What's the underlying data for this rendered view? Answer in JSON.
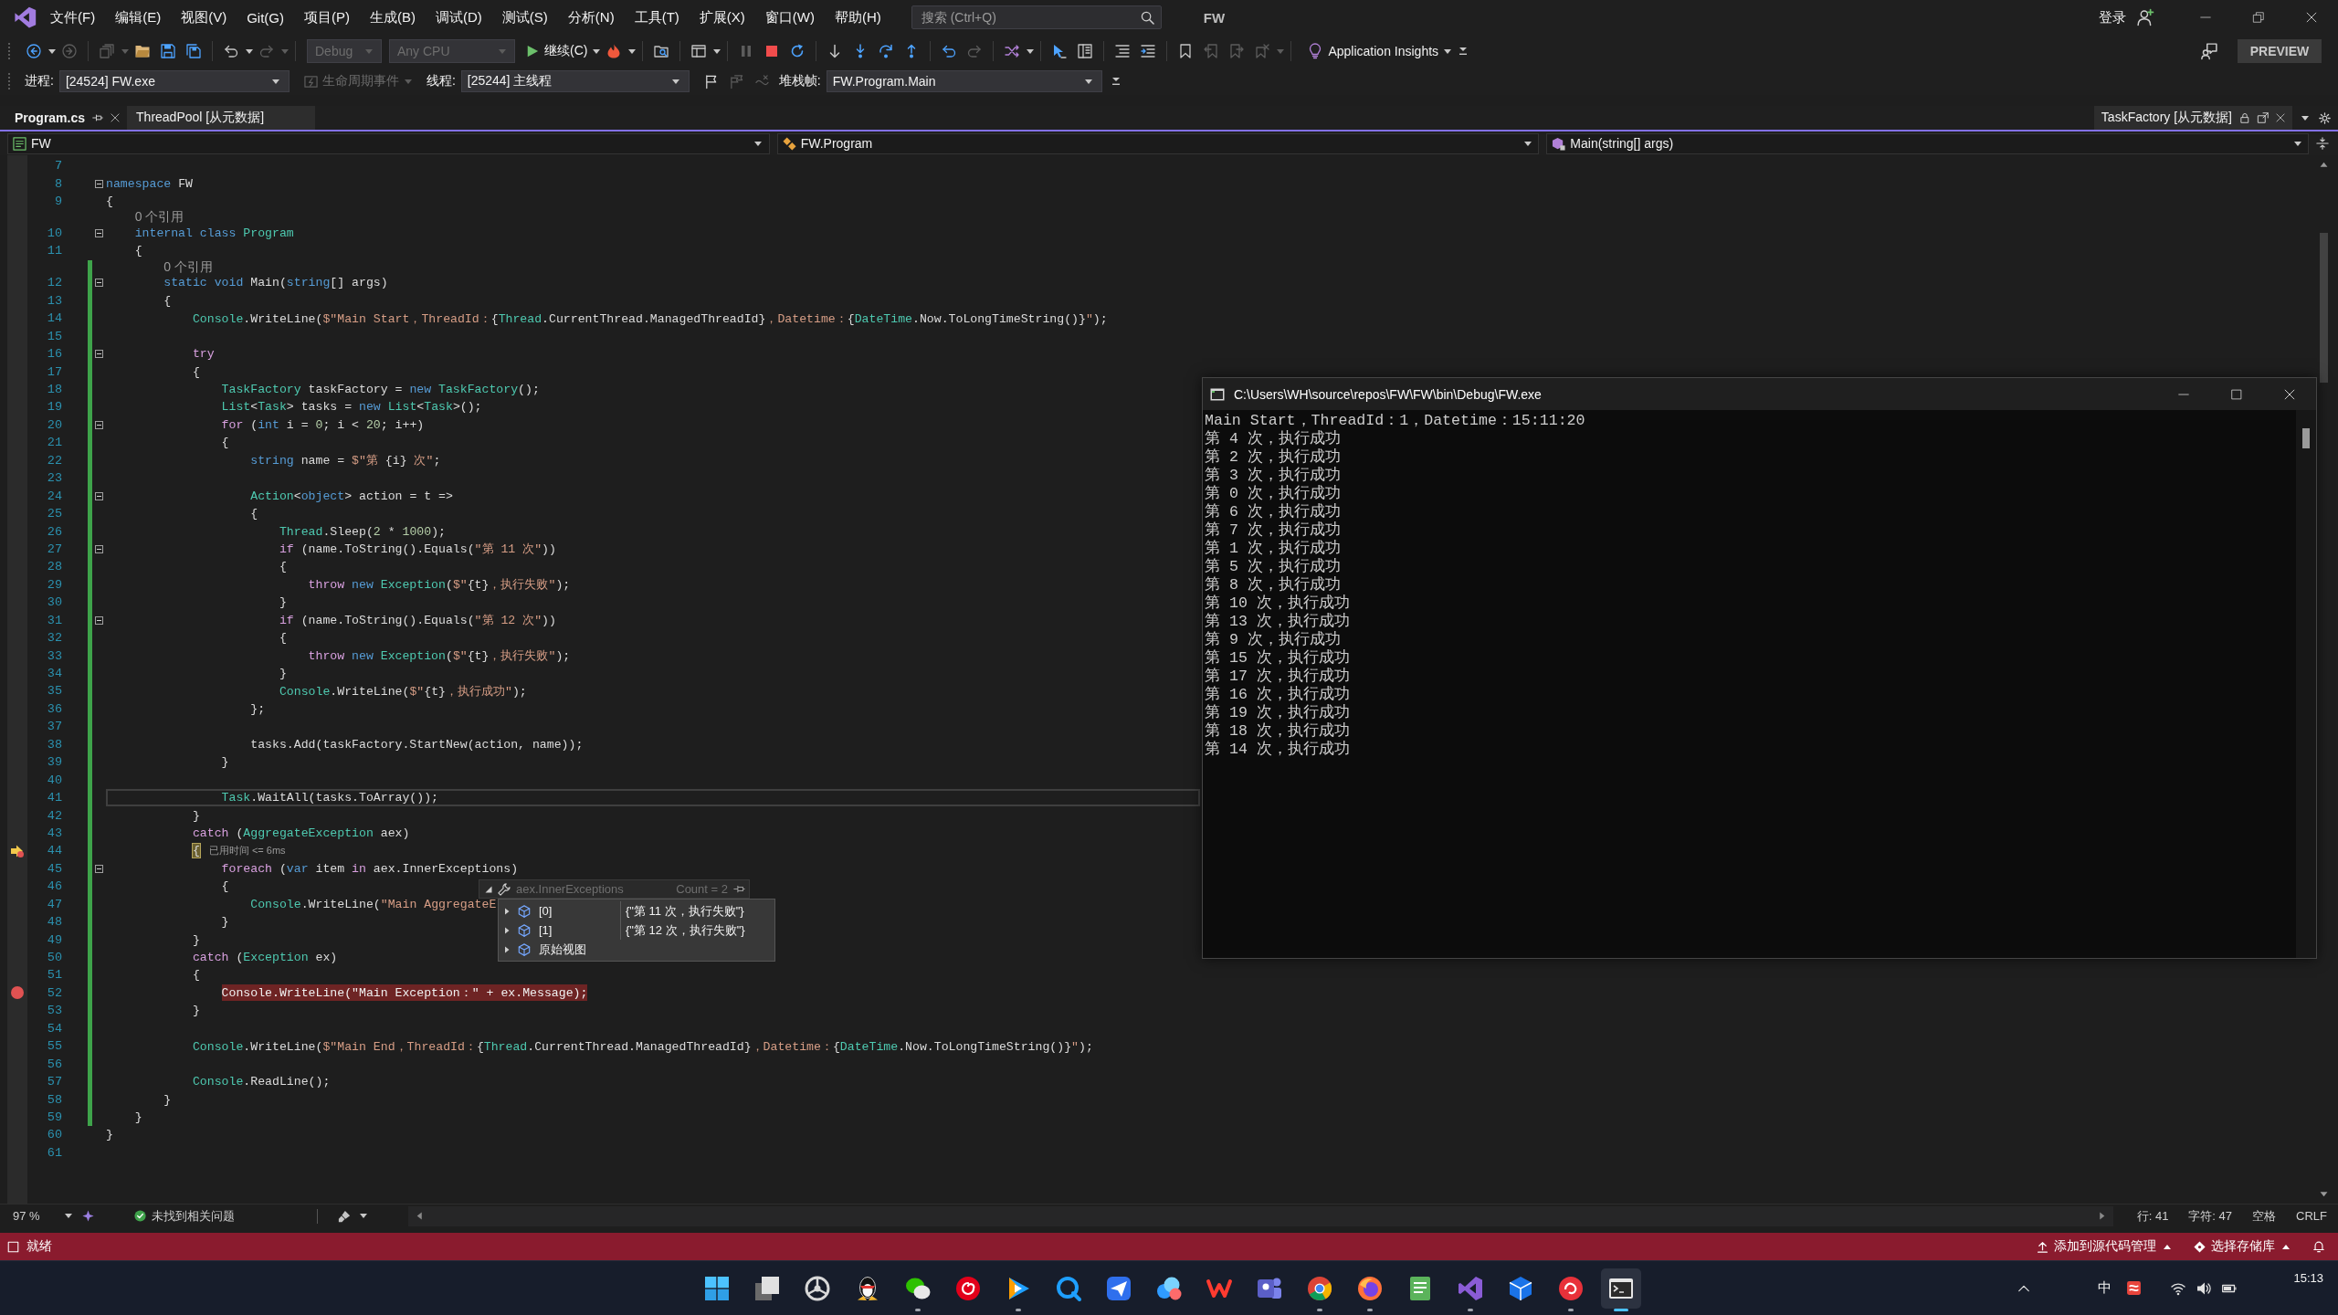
{
  "title_bar": {
    "menu": [
      "文件(F)",
      "编辑(E)",
      "视图(V)",
      "Git(G)",
      "项目(P)",
      "生成(B)",
      "调试(D)",
      "测试(S)",
      "分析(N)",
      "工具(T)",
      "扩展(X)",
      "窗口(W)",
      "帮助(H)"
    ],
    "search": {
      "placeholder": "搜索 (Ctrl+Q)"
    },
    "solution": "FW",
    "sign_in": "登录"
  },
  "standard_toolbar": {
    "groups": [
      [
        {
          "kind": "back",
          "disabled": false
        },
        {
          "kind": "forward",
          "disabled": true
        }
      ],
      [
        {
          "kind": "new-item",
          "disabled": true
        },
        {
          "kind": "open-folder",
          "disabled": false
        },
        {
          "kind": "save",
          "disabled": false
        },
        {
          "kind": "save-all",
          "disabled": false
        }
      ],
      [
        {
          "kind": "undo",
          "disabled": false
        },
        {
          "kind": "redo",
          "disabled": true
        }
      ],
      [
        {
          "kind": "dropdown",
          "label": "Debug",
          "disabled": true
        },
        {
          "kind": "dropdown",
          "label": "Any CPU",
          "disabled": true
        },
        {
          "kind": "continue",
          "label": "继续(C)",
          "disabled": false
        },
        {
          "kind": "hot-reload",
          "disabled": false
        }
      ],
      [
        {
          "kind": "find",
          "disabled": false
        }
      ],
      [
        {
          "kind": "windows",
          "disabled": false
        }
      ],
      [
        {
          "kind": "pause",
          "disabled": true
        },
        {
          "kind": "stop",
          "disabled": false
        },
        {
          "kind": "restart",
          "disabled": false
        }
      ],
      [
        {
          "kind": "show-next",
          "disabled": false
        },
        {
          "kind": "step-into",
          "disabled": false
        },
        {
          "kind": "step-over",
          "disabled": false
        },
        {
          "kind": "step-out",
          "disabled": false
        }
      ],
      [
        {
          "kind": "step-back",
          "disabled": false
        },
        {
          "kind": "step-forward",
          "disabled": true
        }
      ],
      [
        {
          "kind": "threads",
          "disabled": false
        }
      ],
      [
        {
          "kind": "pointer",
          "disabled": false
        },
        {
          "kind": "columns",
          "disabled": false
        }
      ],
      [
        {
          "kind": "comment",
          "disabled": false
        },
        {
          "kind": "uncomment",
          "disabled": false
        }
      ],
      [
        {
          "kind": "bookmark",
          "disabled": false
        },
        {
          "kind": "bookmark-prev",
          "disabled": true
        },
        {
          "kind": "bookmark-next",
          "disabled": true
        },
        {
          "kind": "bookmark-clear",
          "disabled": true
        }
      ],
      [
        {
          "kind": "insights",
          "label": "Application Insights",
          "disabled": false
        }
      ]
    ],
    "preview_button": "PREVIEW"
  },
  "debug_location_toolbar": {
    "process_label": "进程:",
    "process": "[24524] FW.exe",
    "lifecycle_events": {
      "label": "生命周期事件",
      "disabled": true
    },
    "thread_label": "线程:",
    "thread": "[25244] 主线程",
    "thread_flags": [
      {
        "kind": "flag",
        "disabled": false
      },
      {
        "kind": "flags",
        "disabled": true
      },
      {
        "kind": "filter",
        "disabled": true
      }
    ],
    "stack_frame_label": "堆栈帧:",
    "stack_frame": "FW.Program.Main"
  },
  "document_tabs": [
    {
      "label": "Program.cs",
      "selected": true
    },
    {
      "label": "ThreadPool [从元数据]",
      "selected": false
    }
  ],
  "preview_tab": {
    "label": "TaskFactory [从元数据]"
  },
  "navigation_bar": {
    "project": "FW",
    "type": "FW.Program",
    "member": "Main(string[] args)"
  },
  "editor": {
    "lines": [
      {
        "kind": "code",
        "number": "7",
        "changed": false
      },
      {
        "kind": "code",
        "number": "8",
        "changed": false,
        "expanded": true,
        "tokens": [
          {
            "kind": "keyword",
            "text": "namespace"
          },
          {
            "kind": "plain",
            "text": " FW"
          }
        ]
      },
      {
        "kind": "code",
        "number": "9",
        "changed": false,
        "tokens": [
          {
            "kind": "plain",
            "text": "{"
          }
        ]
      },
      {
        "kind": "codelens",
        "text": "    0 个引用",
        "changed": false
      },
      {
        "kind": "code",
        "number": "10",
        "changed": false,
        "expanded": true,
        "tokens": [
          {
            "kind": "keyword",
            "text": "    internal class "
          },
          {
            "kind": "type",
            "text": "Program"
          }
        ]
      },
      {
        "kind": "code",
        "number": "11",
        "changed": false,
        "tokens": [
          {
            "kind": "plain",
            "text": "    {"
          }
        ]
      },
      {
        "kind": "codelens",
        "text": "        0 个引用",
        "changed": true
      },
      {
        "kind": "code",
        "number": "12",
        "changed": true,
        "expanded": true,
        "tokens": [
          {
            "kind": "keyword",
            "text": "        static void"
          },
          {
            "kind": "plain",
            "text": " Main("
          },
          {
            "kind": "keyword",
            "text": "string"
          },
          {
            "kind": "plain",
            "text": "[] args)"
          }
        ]
      },
      {
        "kind": "code",
        "number": "13",
        "changed": true,
        "tokens": [
          {
            "kind": "plain",
            "text": "        {"
          }
        ]
      },
      {
        "kind": "code",
        "number": "14",
        "changed": true,
        "tokens": [
          {
            "kind": "type",
            "text": "            Console"
          },
          {
            "kind": "plain",
            "text": ".WriteLine("
          },
          {
            "kind": "string",
            "text": "$\"Main Start，ThreadId："
          },
          {
            "kind": "plain",
            "text": "{"
          },
          {
            "kind": "type",
            "text": "Thread"
          },
          {
            "kind": "plain",
            "text": ".CurrentThread.ManagedThreadId}"
          },
          {
            "kind": "string",
            "text": "，Datetime："
          },
          {
            "kind": "plain",
            "text": "{"
          },
          {
            "kind": "type",
            "text": "DateTime"
          },
          {
            "kind": "plain",
            "text": ".Now.ToLongTimeString()}"
          },
          {
            "kind": "string",
            "text": "\""
          },
          {
            "kind": "plain",
            "text": ");"
          }
        ]
      },
      {
        "kind": "code",
        "number": "15",
        "changed": true
      },
      {
        "kind": "code",
        "number": "16",
        "changed": true,
        "expanded": true,
        "tokens": [
          {
            "kind": "control",
            "text": "            try"
          }
        ]
      },
      {
        "kind": "code",
        "number": "17",
        "changed": true,
        "tokens": [
          {
            "kind": "plain",
            "text": "            {"
          }
        ]
      },
      {
        "kind": "code",
        "number": "18",
        "changed": true,
        "tokens": [
          {
            "kind": "type",
            "text": "                TaskFactory"
          },
          {
            "kind": "plain",
            "text": " taskFactory = "
          },
          {
            "kind": "keyword",
            "text": "new "
          },
          {
            "kind": "type",
            "text": "TaskFactory"
          },
          {
            "kind": "plain",
            "text": "();"
          }
        ]
      },
      {
        "kind": "code",
        "number": "19",
        "changed": true,
        "tokens": [
          {
            "kind": "type",
            "text": "                List"
          },
          {
            "kind": "plain",
            "text": "<"
          },
          {
            "kind": "type",
            "text": "Task"
          },
          {
            "kind": "plain",
            "text": "> tasks = "
          },
          {
            "kind": "keyword",
            "text": "new "
          },
          {
            "kind": "type",
            "text": "List"
          },
          {
            "kind": "plain",
            "text": "<"
          },
          {
            "kind": "type",
            "text": "Task"
          },
          {
            "kind": "plain",
            "text": ">();"
          }
        ]
      },
      {
        "kind": "code",
        "number": "20",
        "changed": true,
        "expanded": true,
        "tokens": [
          {
            "kind": "control",
            "text": "                for"
          },
          {
            "kind": "plain",
            "text": " ("
          },
          {
            "kind": "keyword",
            "text": "int"
          },
          {
            "kind": "plain",
            "text": " i = "
          },
          {
            "kind": "number",
            "text": "0"
          },
          {
            "kind": "plain",
            "text": "; i < "
          },
          {
            "kind": "number",
            "text": "20"
          },
          {
            "kind": "plain",
            "text": "; i++)"
          }
        ]
      },
      {
        "kind": "code",
        "number": "21",
        "changed": true,
        "tokens": [
          {
            "kind": "plain",
            "text": "                {"
          }
        ]
      },
      {
        "kind": "code",
        "number": "22",
        "changed": true,
        "tokens": [
          {
            "kind": "keyword",
            "text": "                    string"
          },
          {
            "kind": "plain",
            "text": " name = "
          },
          {
            "kind": "string",
            "text": "$\"第 "
          },
          {
            "kind": "plain",
            "text": "{i}"
          },
          {
            "kind": "string",
            "text": " 次\""
          },
          {
            "kind": "plain",
            "text": ";"
          }
        ]
      },
      {
        "kind": "code",
        "number": "23",
        "changed": true
      },
      {
        "kind": "code",
        "number": "24",
        "changed": true,
        "expanded": true,
        "tokens": [
          {
            "kind": "type",
            "text": "                    Action"
          },
          {
            "kind": "plain",
            "text": "<"
          },
          {
            "kind": "keyword",
            "text": "object"
          },
          {
            "kind": "plain",
            "text": "> action = t =>"
          }
        ]
      },
      {
        "kind": "code",
        "number": "25",
        "changed": true,
        "tokens": [
          {
            "kind": "plain",
            "text": "                    {"
          }
        ]
      },
      {
        "kind": "code",
        "number": "26",
        "changed": true,
        "tokens": [
          {
            "kind": "type",
            "text": "                        Thread"
          },
          {
            "kind": "plain",
            "text": ".Sleep("
          },
          {
            "kind": "number",
            "text": "2"
          },
          {
            "kind": "plain",
            "text": " * "
          },
          {
            "kind": "number",
            "text": "1000"
          },
          {
            "kind": "plain",
            "text": ");"
          }
        ]
      },
      {
        "kind": "code",
        "number": "27",
        "changed": true,
        "expanded": true,
        "tokens": [
          {
            "kind": "control",
            "text": "                        if"
          },
          {
            "kind": "plain",
            "text": " (name.ToString().Equals("
          },
          {
            "kind": "string",
            "text": "\"第 11 次\""
          },
          {
            "kind": "plain",
            "text": "))"
          }
        ]
      },
      {
        "kind": "code",
        "number": "28",
        "changed": true,
        "tokens": [
          {
            "kind": "plain",
            "text": "                        {"
          }
        ]
      },
      {
        "kind": "code",
        "number": "29",
        "changed": true,
        "tokens": [
          {
            "kind": "control",
            "text": "                            throw "
          },
          {
            "kind": "keyword",
            "text": "new "
          },
          {
            "kind": "type",
            "text": "Exception"
          },
          {
            "kind": "plain",
            "text": "("
          },
          {
            "kind": "string",
            "text": "$\""
          },
          {
            "kind": "plain",
            "text": "{t}"
          },
          {
            "kind": "string",
            "text": "，执行失败\""
          },
          {
            "kind": "plain",
            "text": ");"
          }
        ]
      },
      {
        "kind": "code",
        "number": "30",
        "changed": true,
        "tokens": [
          {
            "kind": "plain",
            "text": "                        }"
          }
        ]
      },
      {
        "kind": "code",
        "number": "31",
        "changed": true,
        "expanded": true,
        "tokens": [
          {
            "kind": "control",
            "text": "                        if"
          },
          {
            "kind": "plain",
            "text": " (name.ToString().Equals("
          },
          {
            "kind": "string",
            "text": "\"第 12 次\""
          },
          {
            "kind": "plain",
            "text": "))"
          }
        ]
      },
      {
        "kind": "code",
        "number": "32",
        "changed": true,
        "tokens": [
          {
            "kind": "plain",
            "text": "                        {"
          }
        ]
      },
      {
        "kind": "code",
        "number": "33",
        "changed": true,
        "tokens": [
          {
            "kind": "control",
            "text": "                            throw "
          },
          {
            "kind": "keyword",
            "text": "new "
          },
          {
            "kind": "type",
            "text": "Exception"
          },
          {
            "kind": "plain",
            "text": "("
          },
          {
            "kind": "string",
            "text": "$\""
          },
          {
            "kind": "plain",
            "text": "{t}"
          },
          {
            "kind": "string",
            "text": "，执行失败\""
          },
          {
            "kind": "plain",
            "text": ");"
          }
        ]
      },
      {
        "kind": "code",
        "number": "34",
        "changed": true,
        "tokens": [
          {
            "kind": "plain",
            "text": "                        }"
          }
        ]
      },
      {
        "kind": "code",
        "number": "35",
        "changed": true,
        "tokens": [
          {
            "kind": "type",
            "text": "                        Console"
          },
          {
            "kind": "plain",
            "text": ".WriteLine("
          },
          {
            "kind": "string",
            "text": "$\""
          },
          {
            "kind": "plain",
            "text": "{t}"
          },
          {
            "kind": "string",
            "text": "，执行成功\""
          },
          {
            "kind": "plain",
            "text": ");"
          }
        ]
      },
      {
        "kind": "code",
        "number": "36",
        "changed": true,
        "tokens": [
          {
            "kind": "plain",
            "text": "                    };"
          }
        ]
      },
      {
        "kind": "code",
        "number": "37",
        "changed": true
      },
      {
        "kind": "code",
        "number": "38",
        "changed": true,
        "tokens": [
          {
            "kind": "plain",
            "text": "                    tasks.Add(taskFactory.StartNew(action, name));"
          }
        ]
      },
      {
        "kind": "code",
        "number": "39",
        "changed": true,
        "tokens": [
          {
            "kind": "plain",
            "text": "                }"
          }
        ]
      },
      {
        "kind": "code",
        "number": "40",
        "changed": true
      },
      {
        "kind": "code",
        "number": "41",
        "changed": true,
        "caret_line": true,
        "tokens": [
          {
            "kind": "type",
            "text": "                Task"
          },
          {
            "kind": "plain",
            "text": ".WaitAll(tasks.ToArray());"
          }
        ]
      },
      {
        "kind": "code",
        "number": "42",
        "changed": true,
        "tokens": [
          {
            "kind": "plain",
            "text": "            }"
          }
        ]
      },
      {
        "kind": "code",
        "number": "43",
        "changed": true,
        "tokens": [
          {
            "kind": "control",
            "text": "            catch"
          },
          {
            "kind": "plain",
            "text": " ("
          },
          {
            "kind": "type",
            "text": "AggregateException"
          },
          {
            "kind": "plain",
            "text": " aex)"
          }
        ]
      },
      {
        "kind": "code",
        "number": "44",
        "changed": true,
        "current_statement": true,
        "hint": "已用时间 <= 6ms",
        "tokens": [
          {
            "kind": "plain",
            "text": "            {"
          }
        ]
      },
      {
        "kind": "code",
        "number": "45",
        "changed": true,
        "expanded": true,
        "tokens": [
          {
            "kind": "control",
            "text": "                foreach"
          },
          {
            "kind": "plain",
            "text": " ("
          },
          {
            "kind": "keyword",
            "text": "var"
          },
          {
            "kind": "plain",
            "text": " item "
          },
          {
            "kind": "control",
            "text": "in"
          },
          {
            "kind": "plain",
            "text": " aex.InnerExceptions)"
          }
        ]
      },
      {
        "kind": "code",
        "number": "46",
        "changed": true,
        "tokens": [
          {
            "kind": "plain",
            "text": "                {"
          }
        ]
      },
      {
        "kind": "code",
        "number": "47",
        "changed": true,
        "tokens": [
          {
            "kind": "type",
            "text": "                    Console"
          },
          {
            "kind": "plain",
            "text": ".WriteLine("
          },
          {
            "kind": "string",
            "text": "\"Main AggregateE"
          }
        ]
      },
      {
        "kind": "code",
        "number": "48",
        "changed": true,
        "tokens": [
          {
            "kind": "plain",
            "text": "                }"
          }
        ]
      },
      {
        "kind": "code",
        "number": "49",
        "changed": true,
        "tokens": [
          {
            "kind": "plain",
            "text": "            }"
          }
        ]
      },
      {
        "kind": "code",
        "number": "50",
        "changed": true,
        "tokens": [
          {
            "kind": "control",
            "text": "            catch"
          },
          {
            "kind": "plain",
            "text": " ("
          },
          {
            "kind": "type",
            "text": "Exception"
          },
          {
            "kind": "plain",
            "text": " ex)"
          }
        ]
      },
      {
        "kind": "code",
        "number": "51",
        "changed": true,
        "tokens": [
          {
            "kind": "plain",
            "text": "            {"
          }
        ]
      },
      {
        "kind": "code",
        "number": "52",
        "changed": true,
        "breakpoint": true,
        "tokens": [
          {
            "kind": "plain",
            "text": "                Console.WriteLine(\"Main Exception：\" + ex.Message);"
          }
        ]
      },
      {
        "kind": "code",
        "number": "53",
        "changed": true,
        "tokens": [
          {
            "kind": "plain",
            "text": "            }"
          }
        ]
      },
      {
        "kind": "code",
        "number": "54",
        "changed": true
      },
      {
        "kind": "code",
        "number": "55",
        "changed": true,
        "tokens": [
          {
            "kind": "type",
            "text": "            Console"
          },
          {
            "kind": "plain",
            "text": ".WriteLine("
          },
          {
            "kind": "string",
            "text": "$\"Main End，ThreadId："
          },
          {
            "kind": "plain",
            "text": "{"
          },
          {
            "kind": "type",
            "text": "Thread"
          },
          {
            "kind": "plain",
            "text": ".CurrentThread.ManagedThreadId}"
          },
          {
            "kind": "string",
            "text": "，Datetime："
          },
          {
            "kind": "plain",
            "text": "{"
          },
          {
            "kind": "type",
            "text": "DateTime"
          },
          {
            "kind": "plain",
            "text": ".Now.ToLongTimeString()}"
          },
          {
            "kind": "string",
            "text": "\""
          },
          {
            "kind": "plain",
            "text": ");"
          }
        ]
      },
      {
        "kind": "code",
        "number": "56",
        "changed": true
      },
      {
        "kind": "code",
        "number": "57",
        "changed": true,
        "tokens": [
          {
            "kind": "type",
            "text": "            Console"
          },
          {
            "kind": "plain",
            "text": ".ReadLine();"
          }
        ]
      },
      {
        "kind": "code",
        "number": "58",
        "changed": true,
        "tokens": [
          {
            "kind": "plain",
            "text": "        }"
          }
        ]
      },
      {
        "kind": "code",
        "number": "59",
        "changed": true,
        "tokens": [
          {
            "kind": "plain",
            "text": "    }"
          }
        ]
      },
      {
        "kind": "code",
        "number": "60",
        "changed": false,
        "tokens": [
          {
            "kind": "plain",
            "text": "}"
          }
        ]
      },
      {
        "kind": "code",
        "number": "61",
        "changed": false
      }
    ],
    "datatip": {
      "expression": "aex.InnerExceptions",
      "count": "Count = 2",
      "items": [
        {
          "name": "[0]",
          "value": "{\"第 11 次，执行失败\"}",
          "expanded": false
        },
        {
          "name": "[1]",
          "value": "{\"第 12 次，执行失败\"}",
          "expanded": false
        },
        {
          "name": "原始视图",
          "expanded": false
        }
      ]
    }
  },
  "editor_status": {
    "zoom": "97 %",
    "issues": "未找到相关问题",
    "line": "行: 41",
    "column": "字符: 47",
    "indentation": "空格",
    "line_ending": "CRLF"
  },
  "console_window": {
    "title": "C:\\Users\\WH\\source\\repos\\FW\\FW\\bin\\Debug\\FW.exe",
    "lines": [
      "Main Start，ThreadId：1，Datetime：15:11:20",
      "第 4 次，执行成功",
      "第 2 次，执行成功",
      "第 3 次，执行成功",
      "第 0 次，执行成功",
      "第 6 次，执行成功",
      "第 7 次，执行成功",
      "第 1 次，执行成功",
      "第 5 次，执行成功",
      "第 8 次，执行成功",
      "第 10 次，执行成功",
      "第 13 次，执行成功",
      "第 9 次，执行成功",
      "第 15 次，执行成功",
      "第 17 次，执行成功",
      "第 16 次，执行成功",
      "第 19 次，执行成功",
      "第 18 次，执行成功",
      "第 14 次，执行成功"
    ]
  },
  "status_bar": {
    "state": "就绪",
    "source_control": "添加到源代码管理",
    "repository": "选择存储库"
  },
  "taskbar": {
    "apps": [
      {
        "kind": "start",
        "running": false,
        "selected": false
      },
      {
        "kind": "task-view",
        "running": false,
        "selected": false
      },
      {
        "kind": "wheel",
        "running": false,
        "selected": false
      },
      {
        "kind": "penguin",
        "running": false,
        "selected": false
      },
      {
        "kind": "chat",
        "running": true,
        "selected": false
      },
      {
        "kind": "disc",
        "running": false,
        "selected": false
      },
      {
        "kind": "video",
        "running": true,
        "selected": false
      },
      {
        "kind": "q-circle",
        "running": false,
        "selected": false
      },
      {
        "kind": "bird",
        "running": false,
        "selected": false
      },
      {
        "kind": "cloud",
        "running": false,
        "selected": false
      },
      {
        "kind": "wps",
        "running": false,
        "selected": false
      },
      {
        "kind": "teams",
        "running": false,
        "selected": false
      },
      {
        "kind": "chrome",
        "running": true,
        "selected": false
      },
      {
        "kind": "firefox",
        "running": true,
        "selected": false
      },
      {
        "kind": "editor",
        "running": false,
        "selected": false
      },
      {
        "kind": "vs",
        "running": true,
        "selected": false
      },
      {
        "kind": "cube",
        "running": false,
        "selected": false
      },
      {
        "kind": "red-app",
        "running": true,
        "selected": false
      },
      {
        "kind": "console",
        "running": true,
        "selected": true
      }
    ],
    "input_method": "中",
    "time": "15:13"
  }
}
